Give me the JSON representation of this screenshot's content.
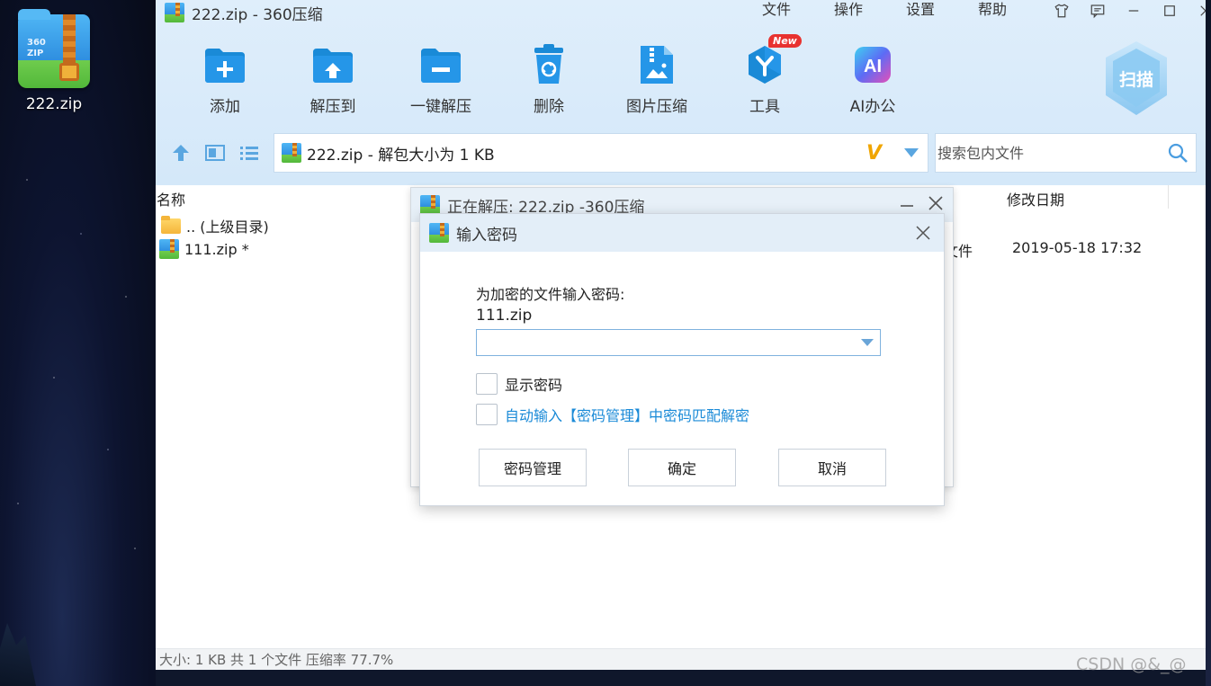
{
  "desktop": {
    "icon_label": "222.zip",
    "icon_badge": "360\nZIP"
  },
  "window": {
    "title": "222.zip - 360压缩",
    "menu": [
      "文件",
      "操作",
      "设置",
      "帮助"
    ]
  },
  "toolbar": {
    "items": [
      {
        "label": "添加",
        "icon": "add-folder-icon"
      },
      {
        "label": "解压到",
        "icon": "extract-to-icon"
      },
      {
        "label": "一键解压",
        "icon": "one-click-extract-icon"
      },
      {
        "label": "删除",
        "icon": "delete-icon"
      },
      {
        "label": "图片压缩",
        "icon": "image-compress-icon"
      },
      {
        "label": "工具",
        "icon": "tools-icon",
        "badge": "New"
      },
      {
        "label": "AI办公",
        "icon": "ai-office-icon",
        "glyph": "AI"
      }
    ],
    "scan_label": "扫描"
  },
  "address": {
    "text": "222.zip - 解包大小为 1 KB",
    "logo": "V"
  },
  "search": {
    "placeholder": "搜索包内文件"
  },
  "list": {
    "headers": {
      "name": "名称",
      "modified": "修改日期"
    },
    "rows": [
      {
        "name": ".. (上级目录)",
        "type": "",
        "modified": ""
      },
      {
        "name": "111.zip *",
        "type": "文件",
        "modified": "2019-05-18 17:32"
      }
    ]
  },
  "statusbar": {
    "text": "大小: 1 KB 共 1 个文件 压缩率 77.7%"
  },
  "watermark": "CSDN @&_@",
  "extract_dialog": {
    "title": "正在解压: 222.zip -360压缩"
  },
  "password_dialog": {
    "title": "输入密码",
    "prompt": "为加密的文件输入密码:",
    "filename": "111.zip",
    "password_value": "",
    "show_password_label": "显示密码",
    "auto_fill_label": "自动输入【密码管理】中密码匹配解密",
    "buttons": {
      "manage": "密码管理",
      "ok": "确定",
      "cancel": "取消"
    }
  },
  "colors": {
    "accent": "#1a8ad7",
    "toolbar_bg": "#d4e8f9",
    "new_badge": "#e8322f"
  }
}
